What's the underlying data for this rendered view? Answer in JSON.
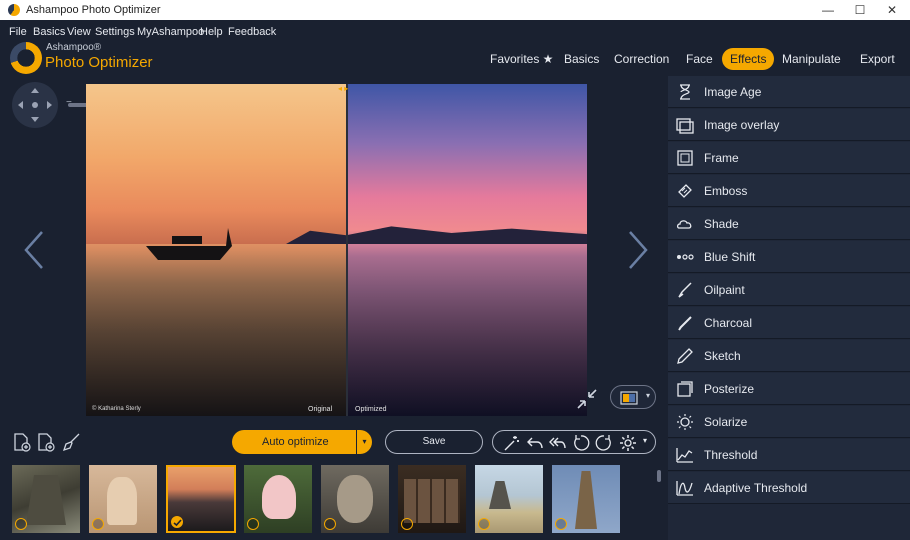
{
  "window": {
    "title": "Ashampoo Photo Optimizer"
  },
  "menu": [
    "File",
    "Basics",
    "View",
    "Settings",
    "MyAshampoo",
    "Help",
    "Feedback"
  ],
  "logo": {
    "brand": "Ashampoo®",
    "product": "Photo Optimizer"
  },
  "tabs": [
    {
      "label": "Favorites ★",
      "active": false
    },
    {
      "label": "Basics",
      "active": false
    },
    {
      "label": "Correction",
      "active": false
    },
    {
      "label": "Face",
      "active": false
    },
    {
      "label": "Effects",
      "active": true
    },
    {
      "label": "Manipulate",
      "active": false
    },
    {
      "label": "Export",
      "active": false
    }
  ],
  "viewer": {
    "zoom_min": "−",
    "zoom_max": "+",
    "credit": "© Katharina Sterly",
    "original_label": "Original",
    "optimized_label": "Optimized",
    "divider_handle": "◂ ▸"
  },
  "effects": [
    {
      "label": "Image Age",
      "icon": "hourglass-icon"
    },
    {
      "label": "Image overlay",
      "icon": "image-overlay-icon"
    },
    {
      "label": "Frame",
      "icon": "frame-icon"
    },
    {
      "label": "Emboss",
      "icon": "emboss-icon"
    },
    {
      "label": "Shade",
      "icon": "shade-icon"
    },
    {
      "label": "Blue Shift",
      "icon": "blue-shift-icon"
    },
    {
      "label": "Oilpaint",
      "icon": "brush-icon"
    },
    {
      "label": "Charcoal",
      "icon": "charcoal-icon"
    },
    {
      "label": "Sketch",
      "icon": "pencil-icon"
    },
    {
      "label": "Posterize",
      "icon": "posterize-icon"
    },
    {
      "label": "Solarize",
      "icon": "solarize-icon"
    },
    {
      "label": "Threshold",
      "icon": "threshold-icon"
    },
    {
      "label": "Adaptive Threshold",
      "icon": "adaptive-threshold-icon"
    }
  ],
  "toolbar": {
    "auto_optimize": "Auto optimize",
    "save": "Save"
  },
  "thumbnails": [
    {
      "subject": "temple ruins",
      "selected": false
    },
    {
      "subject": "cat",
      "selected": false
    },
    {
      "subject": "sunset beach",
      "selected": true
    },
    {
      "subject": "spoonbill bird",
      "selected": false
    },
    {
      "subject": "monkey",
      "selected": false
    },
    {
      "subject": "barrels",
      "selected": false
    },
    {
      "subject": "seaside rocks",
      "selected": false
    },
    {
      "subject": "owl in tree",
      "selected": false
    }
  ],
  "colors": {
    "accent": "#f5a800",
    "background": "#1a2130",
    "panel": "#222b3d"
  }
}
